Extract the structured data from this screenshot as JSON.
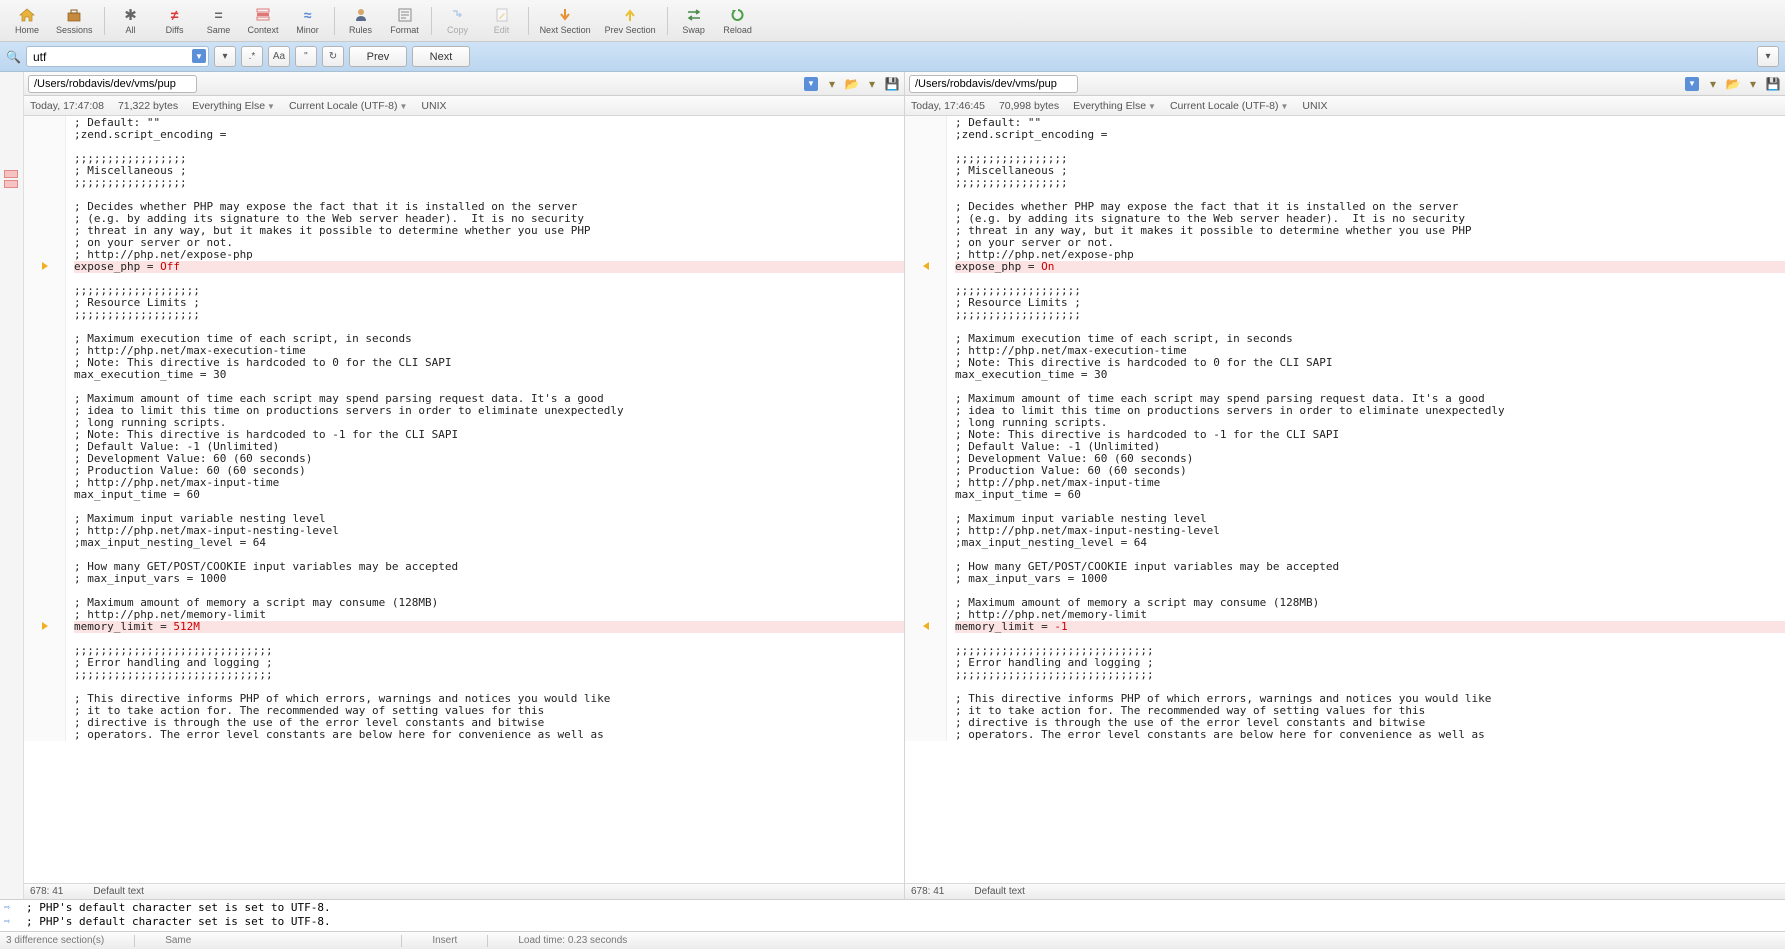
{
  "toolbar": {
    "home": "Home",
    "sessions": "Sessions",
    "all": "All",
    "diffs": "Diffs",
    "same": "Same",
    "context": "Context",
    "minor": "Minor",
    "rules": "Rules",
    "format": "Format",
    "copy": "Copy",
    "edit": "Edit",
    "next_section": "Next Section",
    "prev_section": "Prev Section",
    "swap": "Swap",
    "reload": "Reload"
  },
  "search": {
    "value": "utf",
    "prev": "Prev",
    "next": "Next",
    "regex_btn": ".*",
    "case_btn": "Aa"
  },
  "left": {
    "path": "/Users/robdavis/dev/vms/puphpet/php.ini.apache",
    "timestamp": "Today, 17:47:08",
    "bytes": "71,322 bytes",
    "everything": "Everything Else",
    "locale": "Current Locale (UTF-8)",
    "lineend": "UNIX",
    "coord": "678: 41",
    "coord_label": "Default text"
  },
  "right": {
    "path": "/Users/robdavis/dev/vms/puphpet/php.ini.cli",
    "timestamp": "Today, 17:46:45",
    "bytes": "70,998 bytes",
    "everything": "Everything Else",
    "locale": "Current Locale (UTF-8)",
    "lineend": "UNIX",
    "coord": "678: 41",
    "coord_label": "Default text"
  },
  "code_lines": [
    "; Default: \"\"",
    ";zend.script_encoding =",
    "",
    ";;;;;;;;;;;;;;;;;",
    "; Miscellaneous ;",
    ";;;;;;;;;;;;;;;;;",
    "",
    "; Decides whether PHP may expose the fact that it is installed on the server",
    "; (e.g. by adding its signature to the Web server header).  It is no security",
    "; threat in any way, but it makes it possible to determine whether you use PHP",
    "; on your server or not.",
    "; http://php.net/expose-php",
    "",
    "",
    ";;;;;;;;;;;;;;;;;;;",
    "; Resource Limits ;",
    ";;;;;;;;;;;;;;;;;;;",
    "",
    "; Maximum execution time of each script, in seconds",
    "; http://php.net/max-execution-time",
    "; Note: This directive is hardcoded to 0 for the CLI SAPI",
    "max_execution_time = 30",
    "",
    "; Maximum amount of time each script may spend parsing request data. It's a good",
    "; idea to limit this time on productions servers in order to eliminate unexpectedly",
    "; long running scripts.",
    "; Note: This directive is hardcoded to -1 for the CLI SAPI",
    "; Default Value: -1 (Unlimited)",
    "; Development Value: 60 (60 seconds)",
    "; Production Value: 60 (60 seconds)",
    "; http://php.net/max-input-time",
    "max_input_time = 60",
    "",
    "; Maximum input variable nesting level",
    "; http://php.net/max-input-nesting-level",
    ";max_input_nesting_level = 64",
    "",
    "; How many GET/POST/COOKIE input variables may be accepted",
    "; max_input_vars = 1000",
    "",
    "; Maximum amount of memory a script may consume (128MB)",
    "; http://php.net/memory-limit",
    "",
    "",
    ";;;;;;;;;;;;;;;;;;;;;;;;;;;;;;",
    "; Error handling and logging ;",
    ";;;;;;;;;;;;;;;;;;;;;;;;;;;;;;",
    "",
    "; This directive informs PHP of which errors, warnings and notices you would like",
    "; it to take action for. The recommended way of setting values for this",
    "; directive is through the use of the error level constants and bitwise",
    "; operators. The error level constants are below here for convenience as well as"
  ],
  "diffs": {
    "expose_left_prefix": "expose_php = ",
    "expose_left_val": "Off",
    "expose_right_prefix": "expose_php = ",
    "expose_right_val": "On",
    "memory_left_prefix": "memory_limit = ",
    "memory_left_val": "512M",
    "memory_right_prefix": "memory_limit = ",
    "memory_right_val": "-1"
  },
  "results": {
    "row1": "; PHP's default character set is set to UTF-8.",
    "row2": "; PHP's default character set is set to UTF-8."
  },
  "status": {
    "diff_sections": "3 difference section(s)",
    "same": "Same",
    "insert": "Insert",
    "load_time": "Load time: 0.23 seconds"
  }
}
